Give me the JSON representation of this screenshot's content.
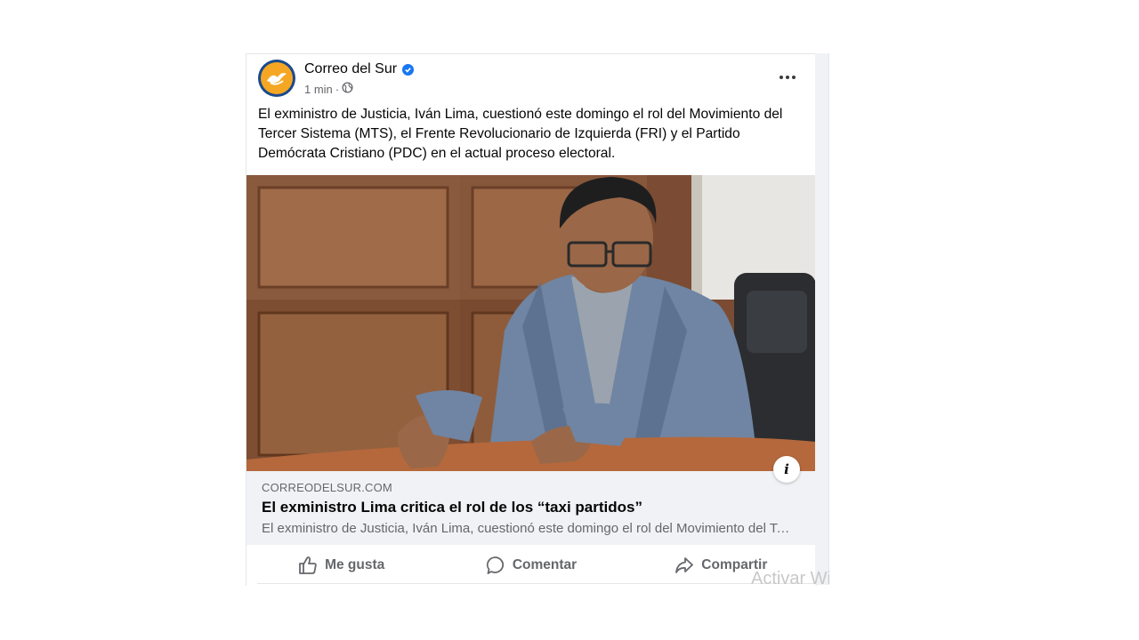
{
  "post": {
    "page_name": "Correo del Sur",
    "timestamp": "1 min",
    "separator": "·",
    "text": "El exministro de Justicia, Iván Lima, cuestionó este domingo el rol del Movimiento del Tercer Sistema (MTS), el Frente Revolucionario de Izquierda (FRI) y el Partido Demócrata Cristiano (PDC) en el actual proceso electoral.",
    "info_glyph": "i"
  },
  "link_preview": {
    "domain": "CORREODELSUR.COM",
    "title": "El exministro Lima critica el rol de los “taxi partidos”",
    "description": "El exministro de Justicia, Iván Lima, cuestionó este domingo el rol del Movimiento del Tercer Sistema (MTS), el Frente Revolucionario de Izquierda (FRI) y el Partido Demócrata Cristiano (PDC)"
  },
  "actions": {
    "like": "Me gusta",
    "comment": "Comentar",
    "share": "Compartir"
  },
  "watermark": "Activar Windows",
  "icons": {
    "avatar": "correo-del-sur-logo",
    "verified": "verified-badge-icon",
    "audience": "globe-icon",
    "more": "more-options-icon",
    "like": "thumbs-up-icon",
    "comment": "comment-bubble-icon",
    "share": "share-arrow-icon"
  },
  "colors": {
    "brand_blue": "#1877f2",
    "secondary_text": "#65676b",
    "preview_bg": "#f0f2f5",
    "logo_orange": "#f5a623",
    "logo_ring": "#1a4a8c"
  }
}
